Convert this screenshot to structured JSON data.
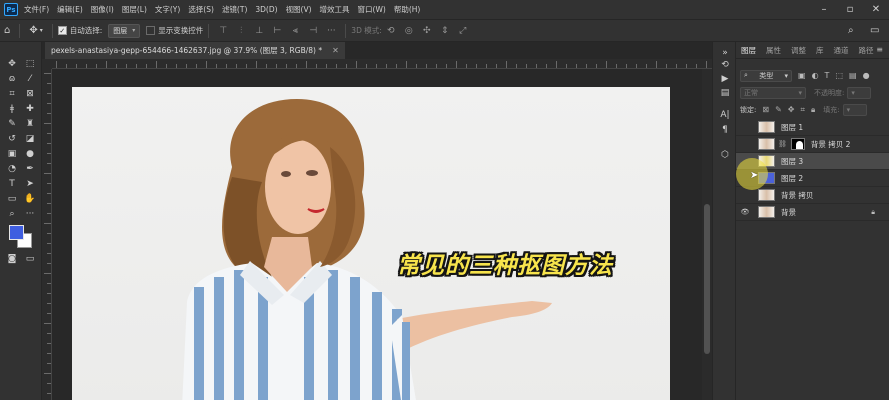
{
  "app": {
    "logo": "Ps",
    "menu": [
      "文件(F)",
      "编辑(E)",
      "图像(I)",
      "图层(L)",
      "文字(Y)",
      "选择(S)",
      "滤镜(T)",
      "3D(D)",
      "视图(V)",
      "增效工具",
      "窗口(W)",
      "帮助(H)"
    ]
  },
  "options_bar": {
    "auto_select_label": "自动选择:",
    "auto_select_checked": true,
    "target_value": "图层",
    "show_transform_label": "显示变换控件",
    "show_transform_checked": false,
    "mode_3d_label": "3D 模式:"
  },
  "document": {
    "tab_title": "pexels-anastasiya-gepp-654466-1462637.jpg @ 37.9% (图层 3, RGB/8) *",
    "overlay_text": "常见的三种抠图方法"
  },
  "colors": {
    "foreground": "#3f5ee0",
    "background": "#ffffff",
    "overlay_text": "#f7e44c"
  },
  "layers_panel": {
    "tabs": [
      "图层",
      "属性",
      "调整",
      "库",
      "通道",
      "路径"
    ],
    "active_tab": "图层",
    "filter_kind": "类型",
    "blend_mode": "正常",
    "opacity_label": "不透明度:",
    "lock_label": "锁定:",
    "fill_label": "填充:",
    "layers": [
      {
        "name": "图层 1",
        "visible": false,
        "selected": false,
        "has_mask": false,
        "thumb": "photo"
      },
      {
        "name": "背景 拷贝 2",
        "visible": false,
        "selected": false,
        "has_mask": true,
        "thumb": "photo"
      },
      {
        "name": "图层 3",
        "visible": false,
        "selected": true,
        "has_mask": false,
        "thumb": "yellow"
      },
      {
        "name": "图层 2",
        "visible": false,
        "selected": false,
        "has_mask": false,
        "thumb": "blue"
      },
      {
        "name": "背景 拷贝",
        "visible": false,
        "selected": false,
        "has_mask": false,
        "thumb": "photo"
      },
      {
        "name": "背景",
        "visible": true,
        "selected": false,
        "has_mask": false,
        "thumb": "photo",
        "locked": true
      }
    ]
  }
}
